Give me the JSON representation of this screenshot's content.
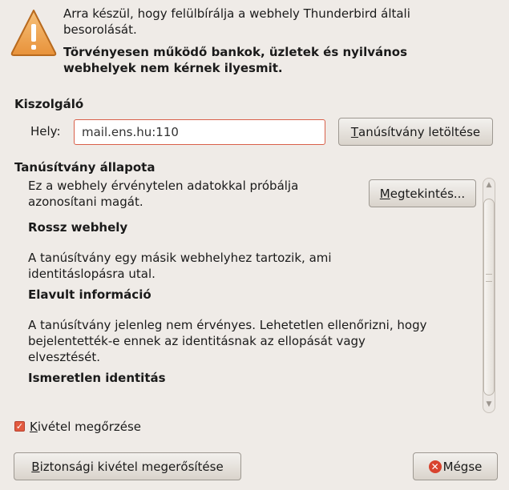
{
  "warning": {
    "line1": "Arra készül, hogy felülbírálja a webhely Thunderbird általi",
    "line2": "besorolását.",
    "bold_line1": "Törvényesen működő bankok, üzletek és nyilvános",
    "bold_line2": "webhelyek nem kérnek ilyesmit."
  },
  "server": {
    "title": "Kiszolgáló",
    "location_label": "Hely:",
    "location_value": "mail.ens.hu:110",
    "get_cert_button": {
      "mnemonic": "T",
      "rest": "anúsítvány letöltése"
    }
  },
  "cert_status": {
    "title": "Tanúsítvány állapota",
    "intro_line1": "Ez a webhely érvénytelen adatokkal próbálja",
    "intro_line2": "azonosítani magát.",
    "view_button": {
      "mnemonic": "M",
      "rest": "egtekintés..."
    },
    "sections": [
      {
        "heading": "Rossz webhely",
        "lines": [
          "A tanúsítvány egy másik webhelyhez tartozik, ami",
          "identitáslopásra utal."
        ]
      },
      {
        "heading": "Elavult információ",
        "lines": [
          "A tanúsítvány jelenleg nem érvényes. Lehetetlen ellenőrizni, hogy",
          "bejelentették-e ennek az identitásnak az ellopását vagy",
          "elvesztését."
        ]
      },
      {
        "heading": "Ismeretlen identitás"
      }
    ]
  },
  "keep_exception": {
    "checked": true,
    "mnemonic": "K",
    "rest": "ivétel megőrzése"
  },
  "buttons": {
    "confirm": {
      "mnemonic": "B",
      "rest": "iztonsági kivétel megerősítése"
    },
    "cancel": {
      "label": "Mégse"
    }
  }
}
